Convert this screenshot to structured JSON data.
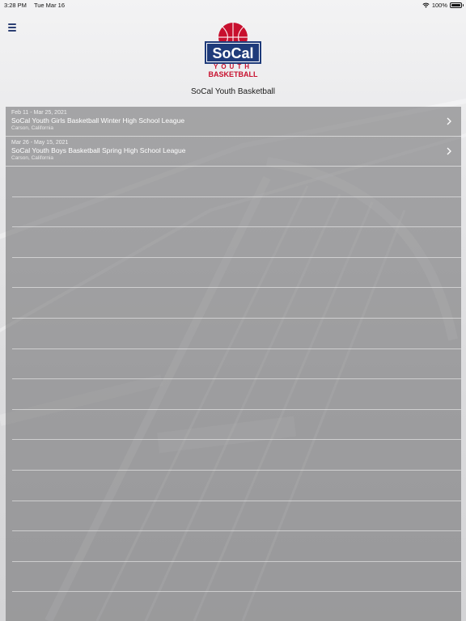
{
  "status_bar": {
    "time": "3:28 PM",
    "date": "Tue Mar 16",
    "battery": "100%"
  },
  "header": {
    "logo": {
      "word_top": "SoCal",
      "word_middle": "YOUTH",
      "word_bottom": "BASKETBALL",
      "primary_color": "#c8102e",
      "secondary_color": "#1f3b7a"
    },
    "title": "SoCal Youth Basketball",
    "menu_icon": "hamburger-menu-icon"
  },
  "leagues": [
    {
      "dates": "Feb 11 - Mar 25, 2021",
      "name": "SoCal Youth Girls Basketball Winter High School League",
      "location": "Carson, California"
    },
    {
      "dates": "Mar 26 - May 15, 2021",
      "name": "SoCal Youth Boys Basketball Spring High School League",
      "location": "Carson, California"
    }
  ],
  "colors": {
    "menu_icon": "#2c3f73",
    "list_text": "#ffffff"
  }
}
